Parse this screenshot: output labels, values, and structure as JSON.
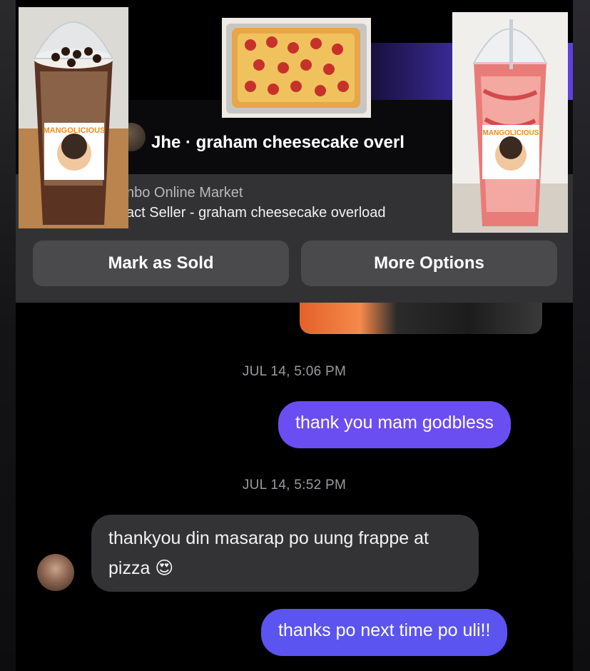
{
  "header": {
    "title": "Jhe · graham cheesecake overl"
  },
  "listing": {
    "market_name": "nbo Online Market",
    "subtitle": "act Seller - graham cheesecake overload"
  },
  "actions": {
    "mark_sold_label": "Mark as Sold",
    "more_options_label": "More Options"
  },
  "photos": {
    "frappe_sticker": "MANGOLICIOUS",
    "strawberry_sticker": "MANGOLICIOUS"
  },
  "messages": [
    {
      "timestamp": "JUL 14, 5:06 PM",
      "text": "thank you mam godbless",
      "direction": "outgoing"
    },
    {
      "timestamp": "JUL 14, 5:52 PM",
      "text": "thankyou din masarap po uung frappe at pizza 😍",
      "direction": "incoming"
    },
    {
      "text": "thanks po next time po uli!!",
      "direction": "outgoing"
    }
  ],
  "colors": {
    "outgoing_bubble": "#6a4ef2",
    "incoming_bubble": "#333336",
    "action_button": "#4a4a4d",
    "accent": "#5b54f0"
  }
}
